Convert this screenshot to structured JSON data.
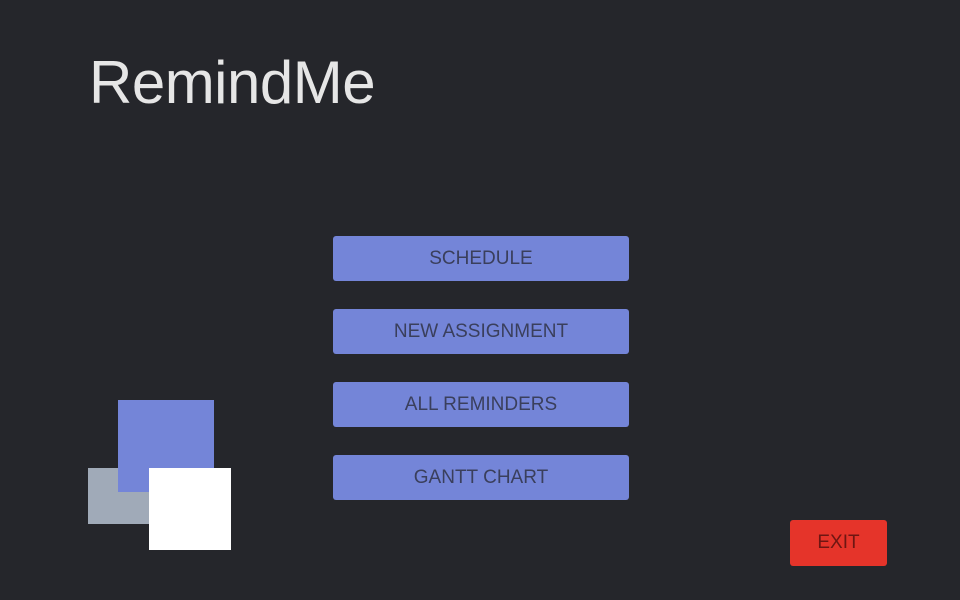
{
  "app": {
    "title": "RemindMe"
  },
  "menu": {
    "items": [
      {
        "label": "SCHEDULE"
      },
      {
        "label": "NEW ASSIGNMENT"
      },
      {
        "label": "ALL REMINDERS"
      },
      {
        "label": "GANTT CHART"
      }
    ]
  },
  "exit": {
    "label": "EXIT"
  },
  "colors": {
    "background": "#25262b",
    "title": "#e6e6e6",
    "accent": "#7485d8",
    "danger": "#e5342a",
    "logo_grey": "#a0aab8",
    "logo_white": "#ffffff"
  }
}
